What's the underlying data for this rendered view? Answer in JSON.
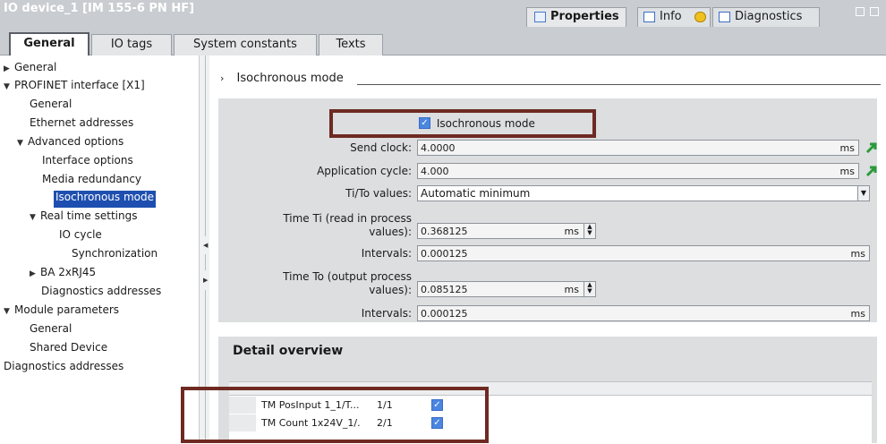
{
  "window": {
    "title": "IO device_1 [IM 155-6 PN HF]",
    "tabs": {
      "properties": "Properties",
      "info": "Info",
      "diagnostics": "Diagnostics"
    }
  },
  "subtabs": [
    "General",
    "IO tags",
    "System constants",
    "Texts"
  ],
  "tree": [
    "General",
    "PROFINET interface [X1]",
    "General",
    "Ethernet addresses",
    "Advanced options",
    "Interface options",
    "Media redundancy",
    "Isochronous mode",
    "Real time settings",
    "IO cycle",
    "Synchronization",
    "BA 2xRJ45",
    "Diagnostics addresses",
    "Module parameters",
    "General",
    "Shared Device",
    "Diagnostics addresses"
  ],
  "section": {
    "title": "Isochronous mode",
    "checkbox_label": "Isochronous mode"
  },
  "form": {
    "send_clock_label": "Send clock:",
    "send_clock_value": "4.0000",
    "send_clock_unit": "ms",
    "app_cycle_label": "Application cycle:",
    "app_cycle_value": "4.000",
    "app_cycle_unit": "ms",
    "ti_to_label": "Ti/To values:",
    "ti_to_value": "Automatic minimum",
    "ti_label_1": "Time Ti (read in process",
    "ti_label_2": "values):",
    "ti_value": "0.368125",
    "ti_unit": "ms",
    "ti_intervals_label": "Intervals:",
    "ti_intervals_value": "0.000125",
    "ti_intervals_unit": "ms",
    "to_label_1": "Time To (output process",
    "to_label_2": "values):",
    "to_value": "0.085125",
    "to_unit": "ms",
    "to_intervals_label": "Intervals:",
    "to_intervals_value": "0.000125",
    "to_intervals_unit": "ms"
  },
  "detail": {
    "title": "Detail overview",
    "rows": [
      {
        "name": "TM PosInput 1_1/T...",
        "slot": "1/1"
      },
      {
        "name": "TM Count 1x24V_1/.",
        "slot": "2/1"
      }
    ]
  },
  "colors": {
    "selection": "#1e4fb0",
    "highlight": "#6e2a22",
    "panel_gray": "#dcdee0"
  }
}
